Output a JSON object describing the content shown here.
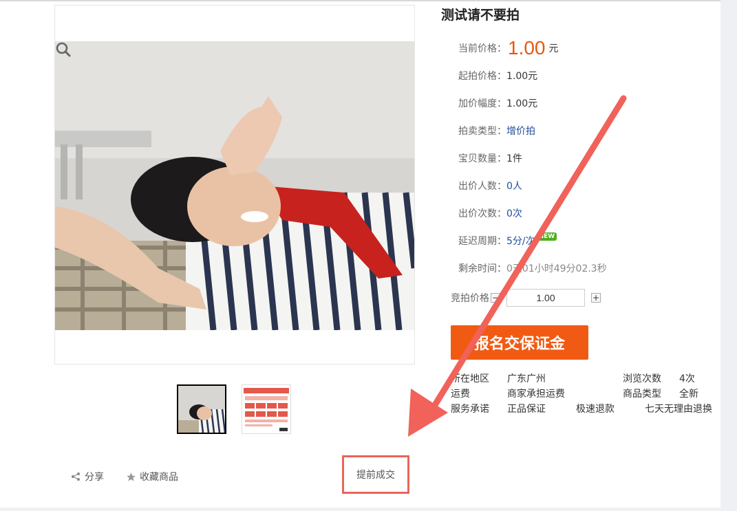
{
  "product": {
    "title": "测试请不要拍"
  },
  "price": {
    "current_label": "当前价格：",
    "current_value": "1.00",
    "current_unit": "元",
    "accent": "#e8580c"
  },
  "fields": [
    {
      "label": "起拍价格：",
      "value": "1.00元"
    },
    {
      "label": "加价幅度：",
      "value": "1.00元"
    },
    {
      "label": "拍卖类型：",
      "value": "增价拍"
    },
    {
      "label": "宝贝数量：",
      "value": "1件"
    },
    {
      "label": "出价人数：",
      "value": "0人"
    },
    {
      "label": "出价次数：",
      "value": "0次"
    },
    {
      "label": "延迟周期：",
      "value": "5分/次",
      "badge": "NEW"
    },
    {
      "label": "剩余时间：",
      "value": "0天01小时49分02.3秒"
    }
  ],
  "bid": {
    "label": "竞拍价格",
    "minus": "−",
    "plus": "+",
    "value": "1.00"
  },
  "cta": {
    "label": "报名交保证金",
    "color": "#f15a13"
  },
  "info": {
    "location_label": "所在地区",
    "location_value": "广东广州",
    "views_label": "浏览次数",
    "views_value": "4次",
    "shipping_label": "运费",
    "shipping_value": "商家承担运费",
    "type_label": "商品类型",
    "type_value": "全新",
    "service_label": "服务承诺",
    "services": [
      "正品保证",
      "极速退款",
      "七天无理由退换"
    ]
  },
  "actions": {
    "share": "分享",
    "favorite": "收藏商品",
    "early_deal": "提前成交"
  },
  "icons": [
    "zoom-icon",
    "share-icon",
    "star-icon"
  ],
  "annotation_color": "#f0625a"
}
